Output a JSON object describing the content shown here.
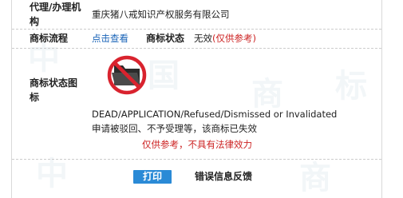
{
  "agent": {
    "label_line1": "代理/办理机",
    "label_line2": "构",
    "value": "重庆猪八戒知识产权服务有限公司"
  },
  "process": {
    "label": "商标流程",
    "link": "点击查看",
    "status_label": "商标状态",
    "status_value": "无效",
    "status_note": "(仅供参考)"
  },
  "status_icon": {
    "label_line1": "商标状态图",
    "label_line2": "标",
    "icon": "prohibited-folder-icon",
    "desc_en": "DEAD/APPLICATION/Refused/Dismissed or Invalidated",
    "desc_cn": "申请被驳回、不予受理等，该商标已失效",
    "disclaimer": "仅供参考，不具有法律效力"
  },
  "actions": {
    "print": "打印",
    "feedback": "错误信息反馈"
  },
  "watermark": [
    "中",
    "国",
    "商",
    "标"
  ],
  "colors": {
    "link": "#1a64b8",
    "red": "#cc2222",
    "button": "#2a8ad6"
  }
}
